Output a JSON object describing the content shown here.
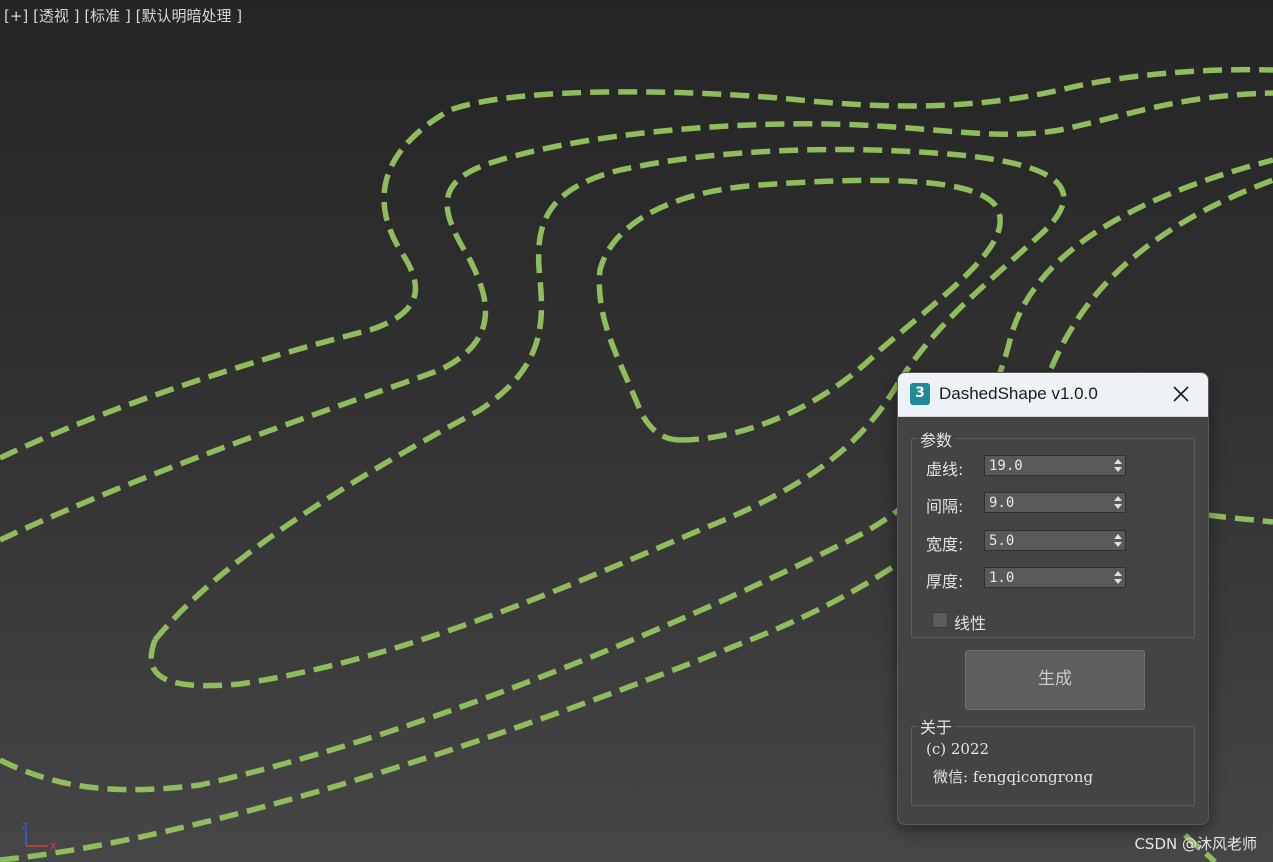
{
  "viewport": {
    "label_plus": "[+]",
    "label_view": "[透视 ]",
    "label_shading_standard": "[标准 ]",
    "label_lighting": "[默认明暗处理 ]",
    "axis_z": "z",
    "axis_x": "x",
    "curve_color": "#8fbc5c"
  },
  "dialog": {
    "icon_text": "3",
    "title": "DashedShape v1.0.0",
    "params_group": {
      "label": "参数",
      "dash": {
        "label": "虚线:",
        "value": "19.0"
      },
      "gap": {
        "label": "间隔:",
        "value": "9.0"
      },
      "width": {
        "label": "宽度:",
        "value": "5.0"
      },
      "thickness": {
        "label": "厚度:",
        "value": "1.0"
      },
      "linear": {
        "label": "线性",
        "checked": false
      }
    },
    "generate_label": "生成",
    "about_group": {
      "label": "关于",
      "copyright": "(c) 2022",
      "wechat": "微信: fengqicongrong"
    }
  },
  "watermark": "CSDN @沐风老师"
}
